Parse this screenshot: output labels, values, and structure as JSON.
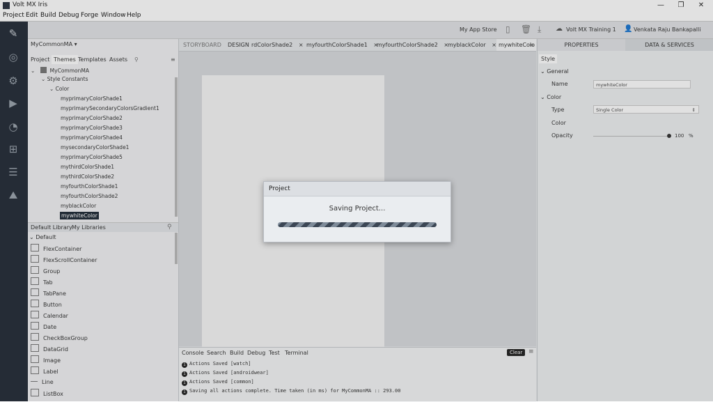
{
  "window": {
    "title": "Volt MX Iris",
    "min": "—",
    "max": "❐",
    "close": "✕"
  },
  "menu": [
    "Project",
    "Edit",
    "Build",
    "Debug",
    "Forge",
    "Window",
    "Help"
  ],
  "toolbar": {
    "app_store": "My App Store",
    "account": "Volt MX Training 1",
    "user": "Venkata Raju Bankapalli"
  },
  "project": {
    "name": "MyCommonMA",
    "tabs": [
      "Project",
      "Themes",
      "Templates",
      "Assets"
    ],
    "tree_root": "MyCommonMA",
    "style_constants": "Style Constants",
    "color_group": "Color",
    "colors": [
      "myprimaryColorShade1",
      "myprimarySecondaryColorsGradient1",
      "myprimaryColorShade2",
      "myprimaryColorShade3",
      "myprimaryColorShade4",
      "mysecondaryColorShade1",
      "myprimaryColorShade5",
      "mythirdColorShade1",
      "mythirdColorShade2",
      "myfourthColorShade1",
      "myfourthColorShade2",
      "myblackColor",
      "mywhiteColor"
    ],
    "selected": "mywhiteColor"
  },
  "library": {
    "tabs": [
      "Default Library",
      "My Libraries"
    ],
    "group": "Default",
    "widgets": [
      "FlexContainer",
      "FlexScrollContainer",
      "Group",
      "Tab",
      "TabPane",
      "Button",
      "Calendar",
      "Date",
      "CheckBoxGroup",
      "DataGrid",
      "Image",
      "Label",
      "Line",
      "ListBox"
    ]
  },
  "editor": {
    "mode_tabs": [
      "STORYBOARD",
      "DESIGN"
    ],
    "tabs": [
      "rdColorShade2",
      "myfourthColorShade1",
      "myfourthColorShade2",
      "myblackColor",
      "mywhiteColo"
    ]
  },
  "console": {
    "tabs": [
      "Console",
      "Search",
      "Build",
      "Debug",
      "Test",
      "Terminal"
    ],
    "clear": "Clear",
    "lines": [
      "Actions Saved [watch]",
      "Actions Saved [androidwear]",
      "Actions Saved [common]",
      "Saving all actions complete. Time taken (in ms) for MyCommonMA :: 293.00"
    ]
  },
  "properties": {
    "tabs": [
      "PROPERTIES",
      "DATA & SERVICES"
    ],
    "subtab": "Style",
    "general": "General",
    "name_label": "Name",
    "name_value": "mywhiteColor",
    "color_section": "Color",
    "type_label": "Type",
    "type_value": "Single Color",
    "color_label": "Color",
    "opacity_label": "Opacity",
    "opacity_value": "100",
    "opacity_unit": "%"
  },
  "dialog": {
    "title": "Project",
    "message": "Saving Project..."
  },
  "colors": {
    "rail": "#252d38",
    "selection": "#1f2a36"
  }
}
